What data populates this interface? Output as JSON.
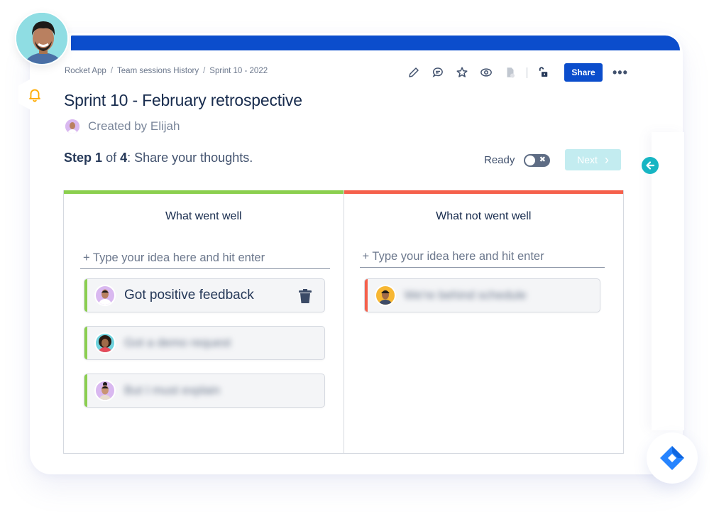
{
  "colors": {
    "brand_blue": "#0b4dcc",
    "teal": "#17b5c3",
    "went_well": "#8bcf4e",
    "not_well": "#f5604b",
    "bell": "#ffab00"
  },
  "header": {
    "user_avatar": "user-avatar",
    "notification_icon": "bell-icon"
  },
  "breadcrumb": [
    {
      "label": "Rocket App"
    },
    {
      "label": "Team sessions History"
    },
    {
      "label": "Sprint 10 - 2022"
    }
  ],
  "breadcrumb_separator": "/",
  "toolbar": {
    "icons": [
      "pencil-icon",
      "comment-icon",
      "star-icon",
      "watch-icon",
      "document-icon",
      "unlock-icon"
    ],
    "share_label": "Share",
    "more_label": "•••"
  },
  "page": {
    "title": "Sprint 10 -  February retrospective",
    "created_by": "Created by Elijah"
  },
  "step": {
    "prefix": "Step",
    "current": "1",
    "of": "of",
    "total": "4",
    "description": ": Share your thoughts."
  },
  "controls": {
    "ready_label": "Ready",
    "ready_on": false,
    "toggle_off_glyph": "✖",
    "next_label": "Next",
    "next_chevron": "›"
  },
  "columns": [
    {
      "title": "What went well",
      "placeholder": "+ Type your idea here and hit enter",
      "items": [
        {
          "text": "Got positive feedback",
          "blurred": false,
          "avatar_bg": "#d9b8f0",
          "deletable": true
        },
        {
          "text": "Got a demo request",
          "blurred": true,
          "avatar_bg": "#6fd3de",
          "deletable": false
        },
        {
          "text": "But I must explain",
          "blurred": true,
          "avatar_bg": "#d9b8f0",
          "deletable": false
        }
      ]
    },
    {
      "title": "What not went well",
      "placeholder": "+ Type your idea here and hit enter",
      "items": [
        {
          "text": "We're behind schedule",
          "blurred": true,
          "avatar_bg": "#f7b733",
          "deletable": false
        }
      ]
    }
  ]
}
